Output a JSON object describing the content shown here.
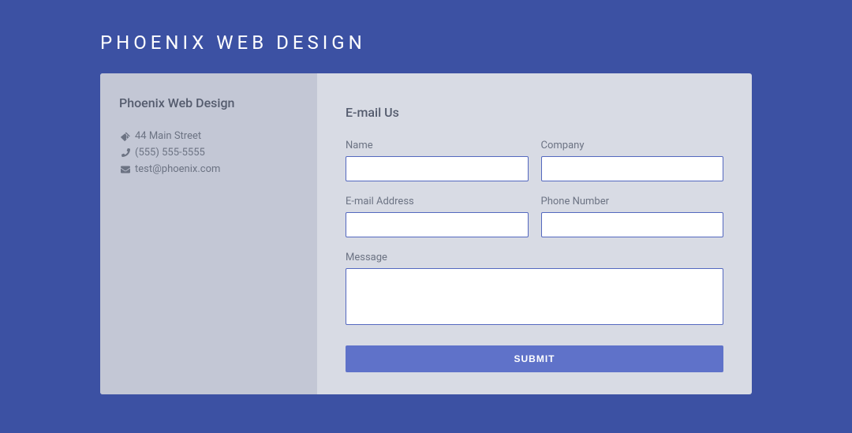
{
  "page": {
    "title": "PHOENIX WEB DESIGN"
  },
  "sidebar": {
    "company_name": "Phoenix Web Design",
    "address": "44 Main Street",
    "phone": "(555) 555-5555",
    "email": "test@phoenix.com"
  },
  "form": {
    "title": "E-mail Us",
    "name_label": "Name",
    "company_label": "Company",
    "email_label": "E-mail Address",
    "phone_label": "Phone Number",
    "message_label": "Message",
    "submit_label": "SUBMIT"
  }
}
